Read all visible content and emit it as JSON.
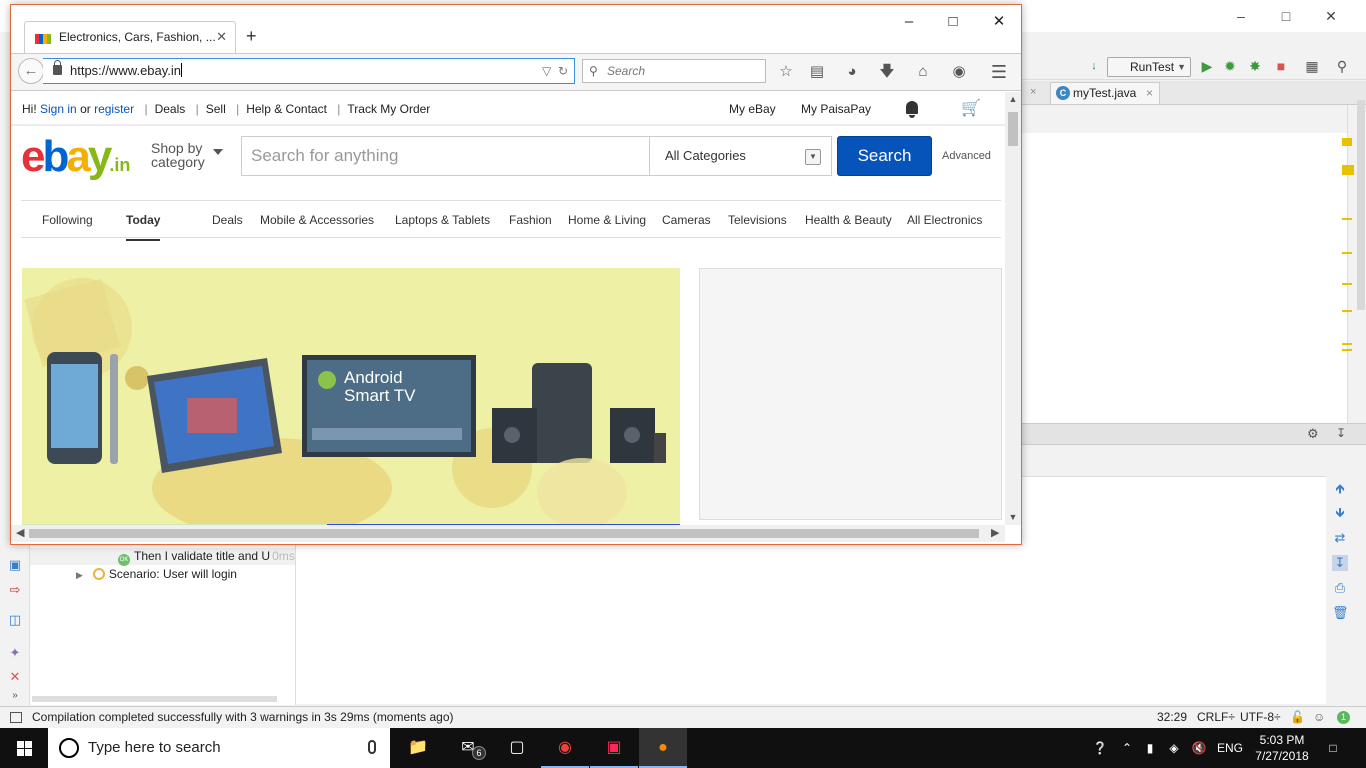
{
  "ide": {
    "runconfig": "RunTest",
    "editor_tab": "myTest.java",
    "tree": {
      "step_label": "Then I validate title and U",
      "step_time": "0ms",
      "scenario_label": "Scenario: User will login"
    },
    "status": {
      "message": "Compilation completed successfully with 3 warnings in 3s 29ms (moments ago)",
      "position": "32:29",
      "line_sep": "CRLF",
      "encoding": "UTF-8"
    }
  },
  "browser": {
    "tab_title": "Electronics, Cars, Fashion, ...",
    "url": "https://www.ebay.in",
    "search_placeholder": "Search"
  },
  "ebay": {
    "top_left": {
      "greeting": "Hi!",
      "sign_in": "Sign in",
      "or": "or",
      "register": "register",
      "links": [
        "Deals",
        "Sell",
        "Help & Contact",
        "Track My Order"
      ]
    },
    "top_right": {
      "my_ebay": "My eBay",
      "my_paisapay": "My PaisaPay"
    },
    "logo": {
      "letters": [
        "e",
        "b",
        "a",
        "y"
      ],
      "letter_colors": [
        "#e53238",
        "#0064d2",
        "#f5af02",
        "#86b817"
      ],
      "suffix": ".in"
    },
    "shop_by": [
      "Shop by",
      "category"
    ],
    "search_placeholder": "Search for anything",
    "category_selected": "All Categories",
    "search_button": "Search",
    "advanced": "Advanced",
    "nav": [
      "Following",
      "Today",
      "Deals",
      "Mobile & Accessories",
      "Laptops & Tablets",
      "Fashion",
      "Home & Living",
      "Cameras",
      "Televisions",
      "Health & Beauty",
      "All Electronics"
    ],
    "nav_active": "Today",
    "banner": {
      "tv_title": "Android",
      "tv_subtitle": "Smart TV"
    }
  },
  "taskbar": {
    "search_placeholder": "Type here to search",
    "mail_badge": "6",
    "language": "ENG",
    "time": "5:03 PM",
    "date": "7/27/2018"
  }
}
